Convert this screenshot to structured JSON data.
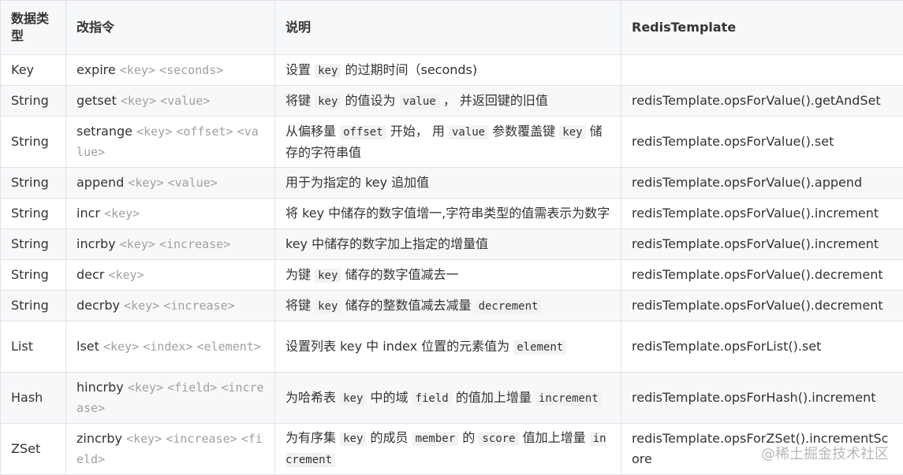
{
  "headers": [
    "数据类型",
    "改指令",
    "说明",
    "RedisTemplate"
  ],
  "rows": [
    {
      "type": "Key",
      "cmd": "expire",
      "args": [
        "<key>",
        "<seconds>"
      ],
      "desc": [
        {
          "t": "设置 "
        },
        {
          "c": "key"
        },
        {
          "t": " 的过期时间（seconds)"
        }
      ],
      "template": ""
    },
    {
      "type": "String",
      "cmd": "getset",
      "args": [
        "<key>",
        "<value>"
      ],
      "desc": [
        {
          "t": "将键 "
        },
        {
          "c": "key"
        },
        {
          "t": " 的值设为 "
        },
        {
          "c": "value"
        },
        {
          "t": " ， 并返回键的旧值"
        }
      ],
      "template": "redisTemplate.opsForValue().getAndSet"
    },
    {
      "type": "String",
      "cmd": "setrange",
      "args": [
        "<key>",
        "<offset>",
        "<value>"
      ],
      "desc": [
        {
          "t": "从偏移量 "
        },
        {
          "c": "offset"
        },
        {
          "t": " 开始， 用 "
        },
        {
          "c": "value"
        },
        {
          "t": " 参数覆盖键 "
        },
        {
          "c": "key"
        },
        {
          "t": " 储存的字符串值"
        }
      ],
      "template": "redisTemplate.opsForValue().set"
    },
    {
      "type": "String",
      "cmd": "append",
      "args": [
        "<key>",
        "<value>"
      ],
      "desc": [
        {
          "t": "用于为指定的 key 追加值"
        }
      ],
      "template": "redisTemplate.opsForValue().append"
    },
    {
      "type": "String",
      "cmd": "incr",
      "args": [
        "<key>"
      ],
      "desc": [
        {
          "t": "将 key 中储存的数字值增一,字符串类型的值需表示为数字"
        }
      ],
      "template": "redisTemplate.opsForValue().increment"
    },
    {
      "type": "String",
      "cmd": "incrby",
      "args": [
        "<key>",
        "<increase>"
      ],
      "desc": [
        {
          "t": "key 中储存的数字加上指定的增量值"
        }
      ],
      "template": "redisTemplate.opsForValue().increment"
    },
    {
      "type": "String",
      "cmd": "decr",
      "args": [
        "<key>"
      ],
      "desc": [
        {
          "t": "为键 "
        },
        {
          "c": "key"
        },
        {
          "t": " 储存的数字值减去一"
        }
      ],
      "template": "redisTemplate.opsForValue().decrement"
    },
    {
      "type": "String",
      "cmd": "decrby",
      "args": [
        "<key>",
        "<increase>"
      ],
      "desc": [
        {
          "t": "将键 "
        },
        {
          "c": "key"
        },
        {
          "t": " 储存的整数值减去减量 "
        },
        {
          "c": "decrement"
        }
      ],
      "template": "redisTemplate.opsForValue().decrement"
    },
    {
      "type": "List",
      "cmd": "lset",
      "args": [
        "<key>",
        "<index>",
        "<element>"
      ],
      "desc": [
        {
          "t": "设置列表 key 中 index 位置的元素值为 "
        },
        {
          "c": "element"
        }
      ],
      "template": "redisTemplate.opsForList().set"
    },
    {
      "type": "Hash",
      "cmd": "hincrby",
      "args": [
        "<key>",
        "<field>",
        "<increase>"
      ],
      "desc": [
        {
          "t": "为哈希表 "
        },
        {
          "c": "key"
        },
        {
          "t": " 中的域 "
        },
        {
          "c": "field"
        },
        {
          "t": " 的值加上增量 "
        },
        {
          "c": "increment"
        }
      ],
      "template": "redisTemplate.opsForHash().increment"
    },
    {
      "type": "ZSet",
      "cmd": "zincrby",
      "args": [
        "<key>",
        "<increase>",
        "<field>"
      ],
      "desc": [
        {
          "t": "为有序集 "
        },
        {
          "c": "key"
        },
        {
          "t": " 的成员 "
        },
        {
          "c": "member"
        },
        {
          "t": " 的 "
        },
        {
          "c": "score"
        },
        {
          "t": " 值加上增量 "
        },
        {
          "c": "increment"
        }
      ],
      "template": "redisTemplate.opsForZSet().incrementScore"
    }
  ],
  "watermark": "@稀土掘金技术社区"
}
